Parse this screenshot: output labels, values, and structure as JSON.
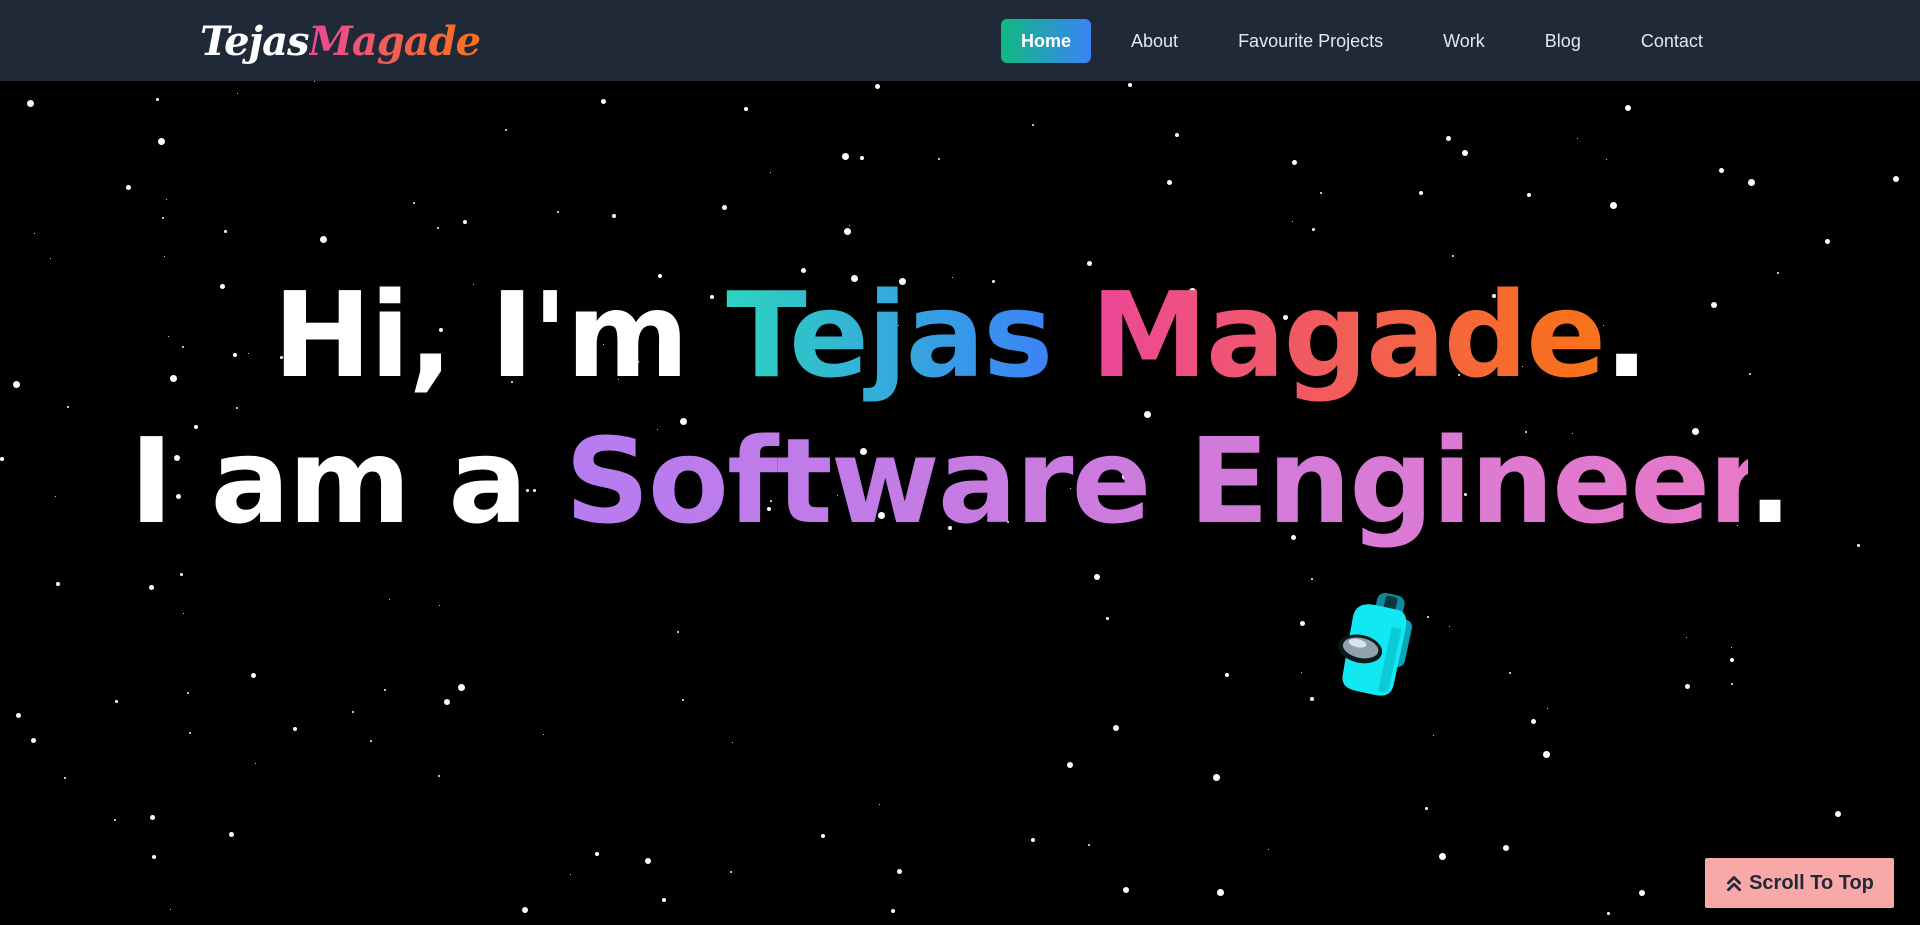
{
  "nav": {
    "logo_first": "Tejas",
    "logo_last": "Magade",
    "links": [
      {
        "label": "Home",
        "active": true
      },
      {
        "label": "About",
        "active": false
      },
      {
        "label": "Favourite Projects",
        "active": false
      },
      {
        "label": "Work",
        "active": false
      },
      {
        "label": "Blog",
        "active": false
      },
      {
        "label": "Contact",
        "active": false
      }
    ]
  },
  "hero": {
    "line1_prefix": "Hi, I'm ",
    "first_name": "Tejas",
    "last_name": "Magade",
    "line1_suffix": ".",
    "line2_prefix": "I am a ",
    "role": "Software Engineer",
    "line2_suffix": "."
  },
  "scroll_top": {
    "label": "Scroll To Top",
    "icon": "double-chevron-up-icon"
  },
  "colors": {
    "nav_bg": "#1f2937",
    "active_gradient": [
      "#10b981",
      "#3b82f6"
    ],
    "tejas_gradient": [
      "#2dd4bf",
      "#3b82f6"
    ],
    "magade_gradient": [
      "#ec4899",
      "#f97316"
    ],
    "role_gradient": [
      "#b57cf0",
      "#e879c9"
    ],
    "scroll_button_bg": "#f9a8a8"
  }
}
